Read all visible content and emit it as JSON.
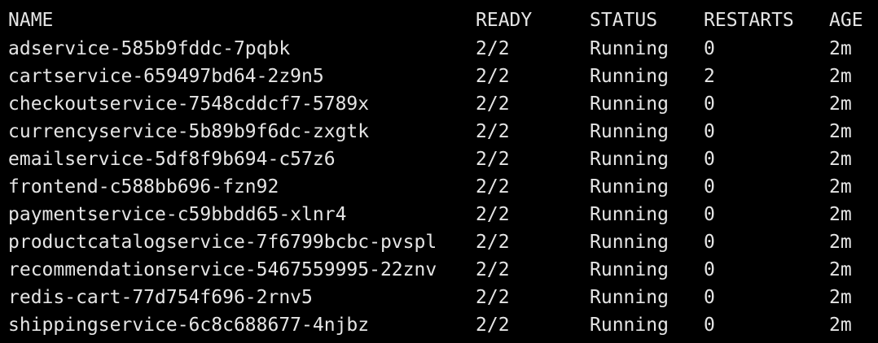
{
  "terminal": {
    "background": "#000000",
    "text_color": "#e5e5e5",
    "columns": {
      "name": "NAME",
      "ready": "READY",
      "status": "STATUS",
      "restarts": "RESTARTS",
      "age": "AGE"
    },
    "pods": [
      {
        "name": "adservice-585b9fddc-7pqbk",
        "ready": "2/2",
        "status": "Running",
        "restarts": "0",
        "age": "2m"
      },
      {
        "name": "cartservice-659497bd64-2z9n5",
        "ready": "2/2",
        "status": "Running",
        "restarts": "2",
        "age": "2m"
      },
      {
        "name": "checkoutservice-7548cddcf7-5789x",
        "ready": "2/2",
        "status": "Running",
        "restarts": "0",
        "age": "2m"
      },
      {
        "name": "currencyservice-5b89b9f6dc-zxgtk",
        "ready": "2/2",
        "status": "Running",
        "restarts": "0",
        "age": "2m"
      },
      {
        "name": "emailservice-5df8f9b694-c57z6",
        "ready": "2/2",
        "status": "Running",
        "restarts": "0",
        "age": "2m"
      },
      {
        "name": "frontend-c588bb696-fzn92",
        "ready": "2/2",
        "status": "Running",
        "restarts": "0",
        "age": "2m"
      },
      {
        "name": "paymentservice-c59bbdd65-xlnr4",
        "ready": "2/2",
        "status": "Running",
        "restarts": "0",
        "age": "2m"
      },
      {
        "name": "productcatalogservice-7f6799bcbc-pvspl",
        "ready": "2/2",
        "status": "Running",
        "restarts": "0",
        "age": "2m"
      },
      {
        "name": "recommendationservice-5467559995-22znv",
        "ready": "2/2",
        "status": "Running",
        "restarts": "0",
        "age": "2m"
      },
      {
        "name": "redis-cart-77d754f696-2rnv5",
        "ready": "2/2",
        "status": "Running",
        "restarts": "0",
        "age": "2m"
      },
      {
        "name": "shippingservice-6c8c688677-4njbz",
        "ready": "2/2",
        "status": "Running",
        "restarts": "0",
        "age": "2m"
      }
    ]
  }
}
